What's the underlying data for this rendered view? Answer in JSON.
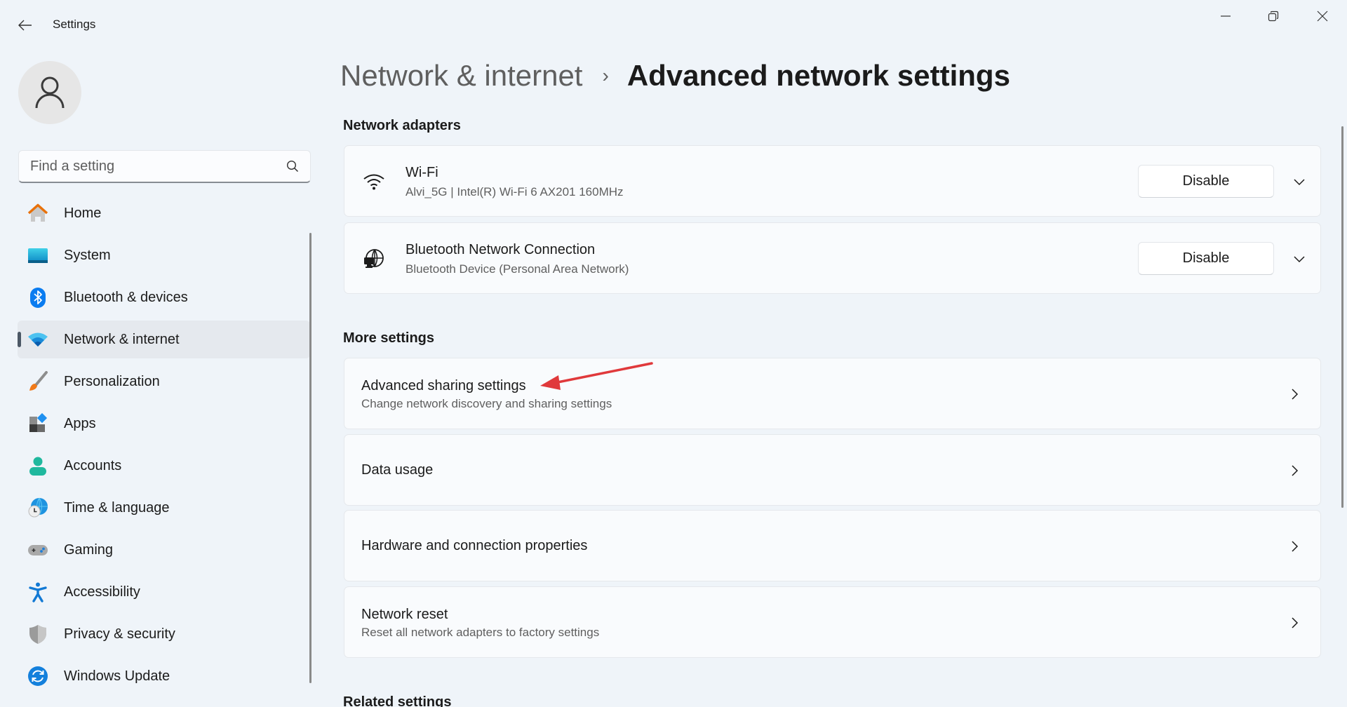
{
  "window": {
    "title": "Settings",
    "controls": {
      "minimize": "minimize-icon",
      "restore": "restore-icon",
      "close": "close-icon"
    }
  },
  "sidebar": {
    "search_placeholder": "Find a setting",
    "items": [
      {
        "label": "Home",
        "icon": "home-icon",
        "selected": false
      },
      {
        "label": "System",
        "icon": "system-icon",
        "selected": false
      },
      {
        "label": "Bluetooth & devices",
        "icon": "bluetooth-icon",
        "selected": false
      },
      {
        "label": "Network & internet",
        "icon": "wifi-icon",
        "selected": true
      },
      {
        "label": "Personalization",
        "icon": "brush-icon",
        "selected": false
      },
      {
        "label": "Apps",
        "icon": "apps-icon",
        "selected": false
      },
      {
        "label": "Accounts",
        "icon": "account-icon",
        "selected": false
      },
      {
        "label": "Time & language",
        "icon": "time-language-icon",
        "selected": false
      },
      {
        "label": "Gaming",
        "icon": "gamepad-icon",
        "selected": false
      },
      {
        "label": "Accessibility",
        "icon": "accessibility-icon",
        "selected": false
      },
      {
        "label": "Privacy & security",
        "icon": "shield-icon",
        "selected": false
      },
      {
        "label": "Windows Update",
        "icon": "update-icon",
        "selected": false
      }
    ]
  },
  "breadcrumb": {
    "parent": "Network & internet",
    "separator": "›",
    "current": "Advanced network settings"
  },
  "network_adapters": {
    "heading": "Network adapters",
    "adapters": [
      {
        "name": "Wi-Fi",
        "detail": "Alvi_5G | Intel(R) Wi-Fi 6 AX201 160MHz",
        "icon": "wifi-icon",
        "action": "Disable"
      },
      {
        "name": "Bluetooth Network Connection",
        "detail": "Bluetooth Device (Personal Area Network)",
        "icon": "network-globe-icon",
        "action": "Disable"
      }
    ]
  },
  "more_settings": {
    "heading": "More settings",
    "items": [
      {
        "title": "Advanced sharing settings",
        "subtitle": "Change network discovery and sharing settings"
      },
      {
        "title": "Data usage",
        "subtitle": ""
      },
      {
        "title": "Hardware and connection properties",
        "subtitle": ""
      },
      {
        "title": "Network reset",
        "subtitle": "Reset all network adapters to factory settings"
      }
    ]
  },
  "related_settings": {
    "heading": "Related settings"
  },
  "annotation": {
    "type": "arrow",
    "color": "#e0393b",
    "points_to": "Advanced sharing settings"
  },
  "colors": {
    "background": "#eff4f9",
    "card": "#f9fbfd",
    "selected": "#e5e9ee",
    "indicator": "#4c5866",
    "accent_blue": "#0067c0"
  }
}
